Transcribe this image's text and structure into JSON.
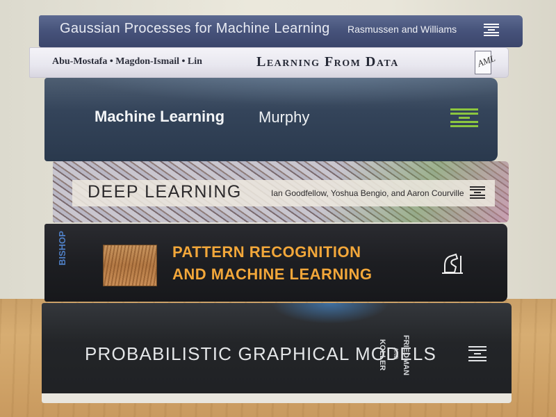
{
  "scene": "stack-of-books",
  "books": [
    {
      "title": "Gaussian Processes for Machine Learning",
      "authors": "Rasmussen and Williams",
      "logo_icon": "mit-press-icon"
    },
    {
      "authors": "Abu-Mostafa • Magdon-Ismail • Lin",
      "title": "Learning From Data",
      "logo_icon": "aml-icon",
      "logo_text": "AML"
    },
    {
      "title": "Machine Learning",
      "authors": "Murphy",
      "logo_icon": "mit-press-icon"
    },
    {
      "title": "DEEP LEARNING",
      "authors": "Ian Goodfellow, Yoshua Bengio, and Aaron Courville",
      "logo_icon": "mit-press-icon"
    },
    {
      "spine_author": "BISHOP",
      "title_line1": "PATTERN RECOGNITION",
      "title_line2": "AND MACHINE LEARNING",
      "logo_icon": "springer-knight-icon"
    },
    {
      "title": "PROBABILISTIC GRAPHICAL MODELS",
      "author1": "KOLLER",
      "author2": "AND",
      "author3": "FRIEDMAN",
      "logo_icon": "mit-press-icon"
    }
  ],
  "colors": {
    "wall": "#e6e3d6",
    "table": "#d0a56b",
    "orange_title": "#f2a73a",
    "green_logo": "#8cc63f",
    "blue_spine": "#4f7fc4"
  }
}
